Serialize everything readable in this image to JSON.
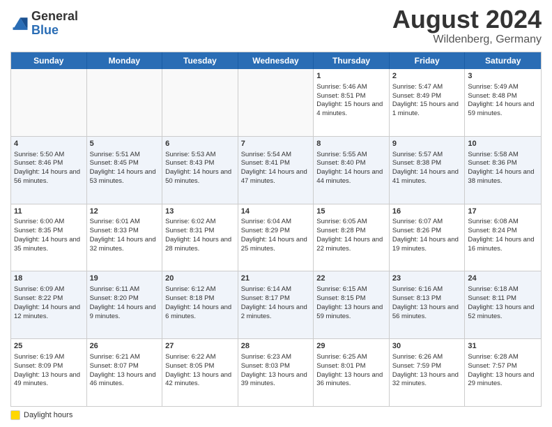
{
  "logo": {
    "general": "General",
    "blue": "Blue"
  },
  "title": "August 2024",
  "location": "Wildenberg, Germany",
  "days_of_week": [
    "Sunday",
    "Monday",
    "Tuesday",
    "Wednesday",
    "Thursday",
    "Friday",
    "Saturday"
  ],
  "footer": {
    "legend_label": "Daylight hours"
  },
  "weeks": [
    [
      {
        "day": "",
        "empty": true
      },
      {
        "day": "",
        "empty": true
      },
      {
        "day": "",
        "empty": true
      },
      {
        "day": "",
        "empty": true
      },
      {
        "day": "1",
        "sunrise": "Sunrise: 5:46 AM",
        "sunset": "Sunset: 8:51 PM",
        "daylight": "Daylight: 15 hours and 4 minutes."
      },
      {
        "day": "2",
        "sunrise": "Sunrise: 5:47 AM",
        "sunset": "Sunset: 8:49 PM",
        "daylight": "Daylight: 15 hours and 1 minute."
      },
      {
        "day": "3",
        "sunrise": "Sunrise: 5:49 AM",
        "sunset": "Sunset: 8:48 PM",
        "daylight": "Daylight: 14 hours and 59 minutes."
      }
    ],
    [
      {
        "day": "4",
        "sunrise": "Sunrise: 5:50 AM",
        "sunset": "Sunset: 8:46 PM",
        "daylight": "Daylight: 14 hours and 56 minutes."
      },
      {
        "day": "5",
        "sunrise": "Sunrise: 5:51 AM",
        "sunset": "Sunset: 8:45 PM",
        "daylight": "Daylight: 14 hours and 53 minutes."
      },
      {
        "day": "6",
        "sunrise": "Sunrise: 5:53 AM",
        "sunset": "Sunset: 8:43 PM",
        "daylight": "Daylight: 14 hours and 50 minutes."
      },
      {
        "day": "7",
        "sunrise": "Sunrise: 5:54 AM",
        "sunset": "Sunset: 8:41 PM",
        "daylight": "Daylight: 14 hours and 47 minutes."
      },
      {
        "day": "8",
        "sunrise": "Sunrise: 5:55 AM",
        "sunset": "Sunset: 8:40 PM",
        "daylight": "Daylight: 14 hours and 44 minutes."
      },
      {
        "day": "9",
        "sunrise": "Sunrise: 5:57 AM",
        "sunset": "Sunset: 8:38 PM",
        "daylight": "Daylight: 14 hours and 41 minutes."
      },
      {
        "day": "10",
        "sunrise": "Sunrise: 5:58 AM",
        "sunset": "Sunset: 8:36 PM",
        "daylight": "Daylight: 14 hours and 38 minutes."
      }
    ],
    [
      {
        "day": "11",
        "sunrise": "Sunrise: 6:00 AM",
        "sunset": "Sunset: 8:35 PM",
        "daylight": "Daylight: 14 hours and 35 minutes."
      },
      {
        "day": "12",
        "sunrise": "Sunrise: 6:01 AM",
        "sunset": "Sunset: 8:33 PM",
        "daylight": "Daylight: 14 hours and 32 minutes."
      },
      {
        "day": "13",
        "sunrise": "Sunrise: 6:02 AM",
        "sunset": "Sunset: 8:31 PM",
        "daylight": "Daylight: 14 hours and 28 minutes."
      },
      {
        "day": "14",
        "sunrise": "Sunrise: 6:04 AM",
        "sunset": "Sunset: 8:29 PM",
        "daylight": "Daylight: 14 hours and 25 minutes."
      },
      {
        "day": "15",
        "sunrise": "Sunrise: 6:05 AM",
        "sunset": "Sunset: 8:28 PM",
        "daylight": "Daylight: 14 hours and 22 minutes."
      },
      {
        "day": "16",
        "sunrise": "Sunrise: 6:07 AM",
        "sunset": "Sunset: 8:26 PM",
        "daylight": "Daylight: 14 hours and 19 minutes."
      },
      {
        "day": "17",
        "sunrise": "Sunrise: 6:08 AM",
        "sunset": "Sunset: 8:24 PM",
        "daylight": "Daylight: 14 hours and 16 minutes."
      }
    ],
    [
      {
        "day": "18",
        "sunrise": "Sunrise: 6:09 AM",
        "sunset": "Sunset: 8:22 PM",
        "daylight": "Daylight: 14 hours and 12 minutes."
      },
      {
        "day": "19",
        "sunrise": "Sunrise: 6:11 AM",
        "sunset": "Sunset: 8:20 PM",
        "daylight": "Daylight: 14 hours and 9 minutes."
      },
      {
        "day": "20",
        "sunrise": "Sunrise: 6:12 AM",
        "sunset": "Sunset: 8:18 PM",
        "daylight": "Daylight: 14 hours and 6 minutes."
      },
      {
        "day": "21",
        "sunrise": "Sunrise: 6:14 AM",
        "sunset": "Sunset: 8:17 PM",
        "daylight": "Daylight: 14 hours and 2 minutes."
      },
      {
        "day": "22",
        "sunrise": "Sunrise: 6:15 AM",
        "sunset": "Sunset: 8:15 PM",
        "daylight": "Daylight: 13 hours and 59 minutes."
      },
      {
        "day": "23",
        "sunrise": "Sunrise: 6:16 AM",
        "sunset": "Sunset: 8:13 PM",
        "daylight": "Daylight: 13 hours and 56 minutes."
      },
      {
        "day": "24",
        "sunrise": "Sunrise: 6:18 AM",
        "sunset": "Sunset: 8:11 PM",
        "daylight": "Daylight: 13 hours and 52 minutes."
      }
    ],
    [
      {
        "day": "25",
        "sunrise": "Sunrise: 6:19 AM",
        "sunset": "Sunset: 8:09 PM",
        "daylight": "Daylight: 13 hours and 49 minutes."
      },
      {
        "day": "26",
        "sunrise": "Sunrise: 6:21 AM",
        "sunset": "Sunset: 8:07 PM",
        "daylight": "Daylight: 13 hours and 46 minutes."
      },
      {
        "day": "27",
        "sunrise": "Sunrise: 6:22 AM",
        "sunset": "Sunset: 8:05 PM",
        "daylight": "Daylight: 13 hours and 42 minutes."
      },
      {
        "day": "28",
        "sunrise": "Sunrise: 6:23 AM",
        "sunset": "Sunset: 8:03 PM",
        "daylight": "Daylight: 13 hours and 39 minutes."
      },
      {
        "day": "29",
        "sunrise": "Sunrise: 6:25 AM",
        "sunset": "Sunset: 8:01 PM",
        "daylight": "Daylight: 13 hours and 36 minutes."
      },
      {
        "day": "30",
        "sunrise": "Sunrise: 6:26 AM",
        "sunset": "Sunset: 7:59 PM",
        "daylight": "Daylight: 13 hours and 32 minutes."
      },
      {
        "day": "31",
        "sunrise": "Sunrise: 6:28 AM",
        "sunset": "Sunset: 7:57 PM",
        "daylight": "Daylight: 13 hours and 29 minutes."
      }
    ]
  ]
}
